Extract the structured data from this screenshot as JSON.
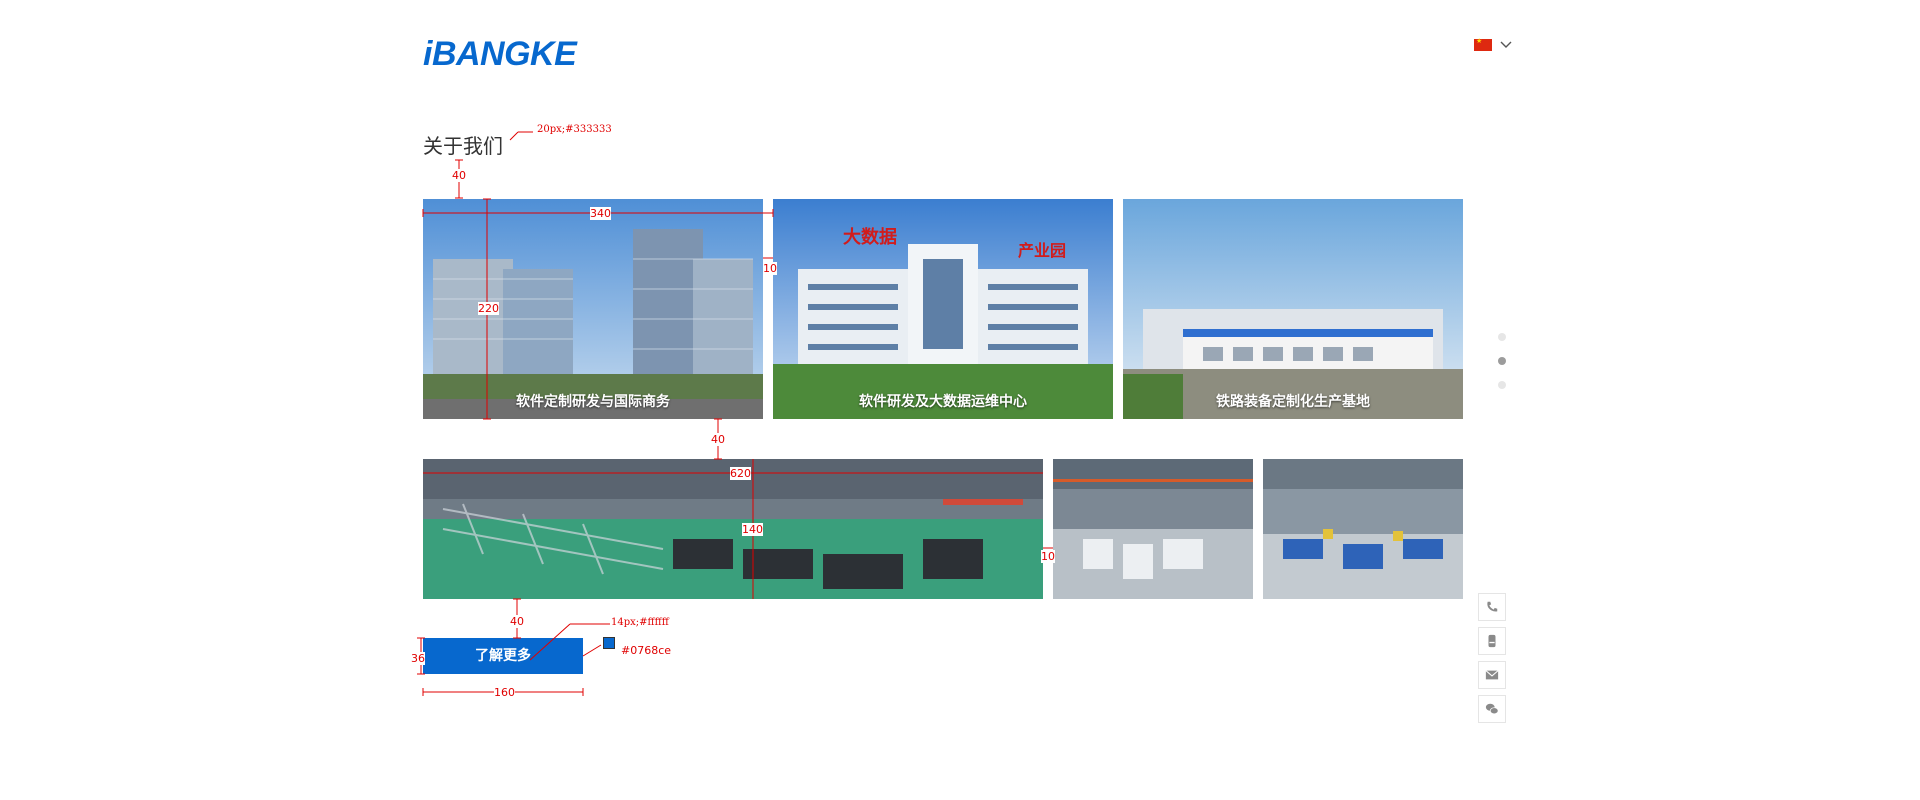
{
  "header": {
    "logo_text": "iBANGKE",
    "language": {
      "flag": "cn-flag",
      "chevron": "chevron-down-icon"
    }
  },
  "section": {
    "title": "关于我们"
  },
  "photos_top": [
    {
      "caption": "软件定制研发与国际商务"
    },
    {
      "caption": "软件研发及大数据运维中心",
      "sign_left": "大数据",
      "sign_right": "产业园"
    },
    {
      "caption": "铁路装备定制化生产基地"
    }
  ],
  "photos_bottom": [
    {
      "caption": ""
    },
    {
      "caption": ""
    },
    {
      "caption": ""
    }
  ],
  "more_button": {
    "label": "了解更多"
  },
  "pagination": {
    "count": 3,
    "active_index": 1
  },
  "side_tools": [
    {
      "name": "phone-icon"
    },
    {
      "name": "mobile-icon"
    },
    {
      "name": "mail-icon"
    },
    {
      "name": "wechat-icon"
    }
  ],
  "annotations": {
    "title_spec": "20px;#333333",
    "gap_title": "40",
    "width_top": "340",
    "height_top": "220",
    "gutter_top": "10",
    "gap_rows": "40",
    "width_bottom": "620",
    "height_bottom": "140",
    "gutter_bottom": "10",
    "gap_button": "40",
    "button_text_spec": "14px;#ffffff",
    "button_color": "#0768ce",
    "button_height": "36",
    "button_width": "160"
  },
  "colors": {
    "brand": "#0768ce",
    "title_text": "#333333",
    "annotation": "#e00000"
  }
}
